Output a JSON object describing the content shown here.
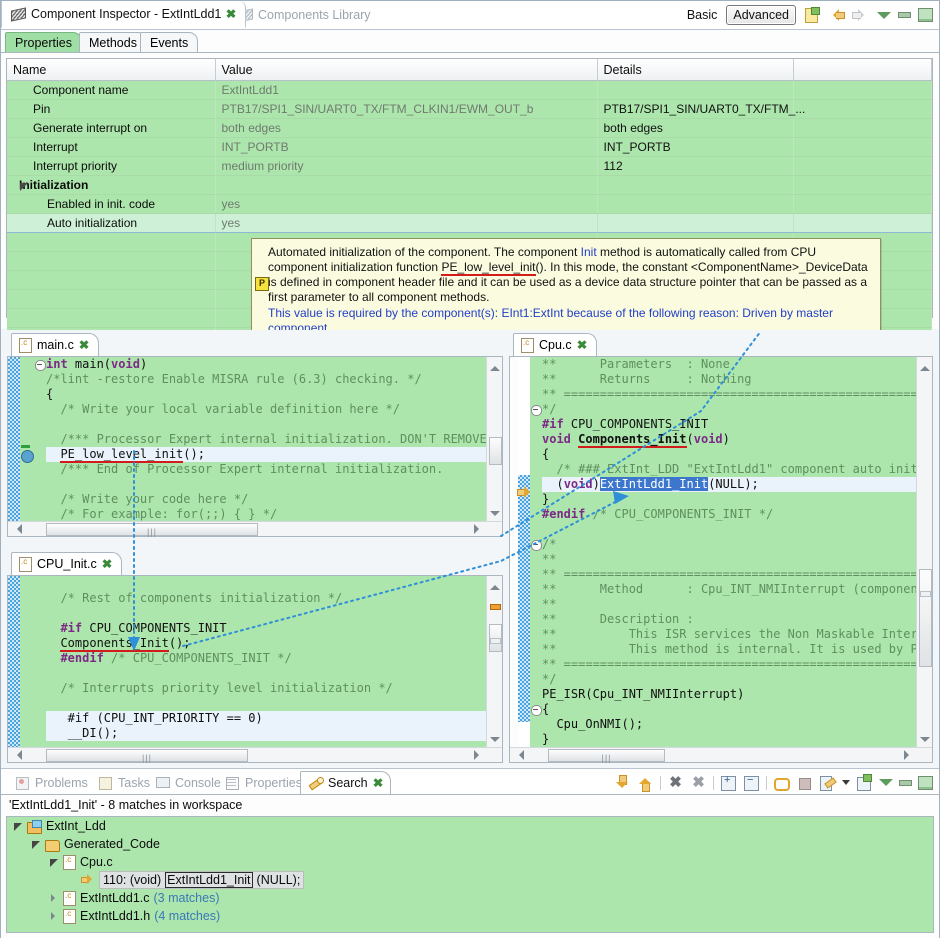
{
  "window": {
    "tabs": [
      {
        "label": "Component Inspector - ExtIntLdd1",
        "icon": "component-icon",
        "active": true,
        "closeable": true
      },
      {
        "label": "Components Library",
        "icon": "component-icon",
        "active": false,
        "closeable": false
      }
    ],
    "toolbar": {
      "basic_label": "Basic",
      "advanced_label": "Advanced",
      "icons": [
        "note-add-icon",
        "back-arrow-icon",
        "forward-arrow-icon",
        "view-menu-icon",
        "minimize-icon",
        "maximize-icon"
      ]
    }
  },
  "inspector": {
    "subtabs": [
      {
        "label": "Properties",
        "active": true
      },
      {
        "label": "Methods",
        "active": false
      },
      {
        "label": "Events",
        "active": false
      }
    ],
    "columns": [
      "Name",
      "Value",
      "Details",
      ""
    ],
    "rows": [
      {
        "name": "Component name",
        "value": "ExtIntLdd1",
        "details": "",
        "indent": 1,
        "group": false,
        "selected": false
      },
      {
        "name": "Pin",
        "value": "PTB17/SPI1_SIN/UART0_TX/FTM_CLKIN1/EWM_OUT_b",
        "details": "PTB17/SPI1_SIN/UART0_TX/FTM_...",
        "indent": 1,
        "group": false,
        "selected": false
      },
      {
        "name": "Generate interrupt on",
        "value": "both edges",
        "details": "both edges",
        "indent": 1,
        "group": false,
        "selected": false
      },
      {
        "name": "Interrupt",
        "value": "INT_PORTB",
        "details": "INT_PORTB",
        "indent": 1,
        "group": false,
        "selected": false
      },
      {
        "name": "Interrupt priority",
        "value": "medium priority",
        "details": "112",
        "indent": 1,
        "group": false,
        "selected": false
      },
      {
        "name": "Initialization",
        "value": "",
        "details": "",
        "indent": 0,
        "group": true,
        "selected": false
      },
      {
        "name": "Enabled in init. code",
        "value": "yes",
        "details": "",
        "indent": 2,
        "group": false,
        "selected": false
      },
      {
        "name": "Auto initialization",
        "value": "yes",
        "details": "",
        "indent": 2,
        "group": false,
        "selected": true
      }
    ]
  },
  "tooltip": {
    "seg1": "Automated initialization of the component. The component ",
    "init_word": "Init",
    "seg2": " method is automatically called from CPU component initialization function ",
    "fn": "PE_low_level_init",
    "seg3": "(). In this mode, the constant <ComponentName>_DeviceData is defined in component header file and it can be used as a device data structure pointer that can be passed as a first parameter to all component methods.",
    "required": "This value is required by the component(s): EInt1:ExtInt because of the following reason: Driven by master component.",
    "badge": "P"
  },
  "editors": {
    "main_c": {
      "tab": "main.c",
      "lines": [
        {
          "text": "int main(void)",
          "style": "code"
        },
        {
          "text": "/*lint -restore Enable MISRA rule (6.3) checking. */",
          "style": "comment"
        },
        {
          "text": "{",
          "style": "code"
        },
        {
          "text": "  /* Write your local variable definition here */",
          "style": "comment"
        },
        {
          "text": "",
          "style": "code"
        },
        {
          "text": "  /*** Processor Expert internal initialization. DON'T REMOVE",
          "style": "comment"
        },
        {
          "text": "  PE_low_level_init();",
          "style": "highlight-underlined"
        },
        {
          "text": "  /*** End of Processor Expert internal initialization.",
          "style": "comment"
        },
        {
          "text": "",
          "style": "code"
        },
        {
          "text": "  /* Write your code here */",
          "style": "comment"
        },
        {
          "text": "  /* For example: for(;;) { } */",
          "style": "comment"
        }
      ]
    },
    "cpu_init_c": {
      "tab": "CPU_Init.c",
      "lines": [
        {
          "text": "",
          "style": "code"
        },
        {
          "text": "  /* Rest of components initialization */",
          "style": "comment"
        },
        {
          "text": "",
          "style": "code"
        },
        {
          "text": "  #if CPU_COMPONENTS_INIT",
          "style": "pp"
        },
        {
          "text": "  Components_Init();",
          "style": "underlined"
        },
        {
          "text": "  #endif /* CPU_COMPONENTS_INIT */",
          "style": "pp"
        },
        {
          "text": "",
          "style": "code"
        },
        {
          "text": "  /* Interrupts priority level initialization */",
          "style": "comment"
        },
        {
          "text": "",
          "style": "code"
        },
        {
          "text": "   #if (CPU_INT_PRIORITY == 0)",
          "style": "highlight"
        },
        {
          "text": "   __DI();",
          "style": "highlight"
        }
      ]
    },
    "cpu_c": {
      "tab": "Cpu.c",
      "lines": [
        {
          "text": "**      Parameters  : None",
          "style": "comment"
        },
        {
          "text": "**      Returns     : Nothing",
          "style": "comment"
        },
        {
          "text": "** ===================================================",
          "style": "comment"
        },
        {
          "text": "*/",
          "style": "comment"
        },
        {
          "text": "#if CPU_COMPONENTS_INIT",
          "style": "pp"
        },
        {
          "text": "void Components_Init(void)",
          "style": "underlined-fn"
        },
        {
          "text": "{",
          "style": "code"
        },
        {
          "text": "  /* ### ExtInt_LDD \"ExtIntLdd1\" component auto init",
          "style": "comment"
        },
        {
          "text": "  (void)ExtIntLdd1_Init(NULL);",
          "style": "highlight-selection"
        },
        {
          "text": "}",
          "style": "code"
        },
        {
          "text": "#endif /* CPU_COMPONENTS_INIT */",
          "style": "pp"
        },
        {
          "text": "",
          "style": "code"
        },
        {
          "text": "/*",
          "style": "comment"
        },
        {
          "text": "**",
          "style": "comment"
        },
        {
          "text": "** ===================================================",
          "style": "comment"
        },
        {
          "text": "**      Method      : Cpu_INT_NMIInterrupt (componen",
          "style": "comment"
        },
        {
          "text": "**",
          "style": "comment"
        },
        {
          "text": "**      Description :",
          "style": "comment"
        },
        {
          "text": "**          This ISR services the Non Maskable Interr",
          "style": "comment"
        },
        {
          "text": "**          This method is internal. It is used by Pr",
          "style": "comment"
        },
        {
          "text": "** ===================================================",
          "style": "comment"
        },
        {
          "text": "*/",
          "style": "comment"
        },
        {
          "text": "PE_ISR(Cpu_INT_NMIInterrupt)",
          "style": "code"
        },
        {
          "text": "{",
          "style": "code"
        },
        {
          "text": "  Cpu_OnNMI();",
          "style": "code"
        },
        {
          "text": "}",
          "style": "code"
        }
      ]
    }
  },
  "bottom": {
    "tabs": [
      {
        "label": "Problems",
        "icon": "problems-icon",
        "active": false
      },
      {
        "label": "Tasks",
        "icon": "tasks-icon",
        "active": false
      },
      {
        "label": "Console",
        "icon": "console-icon",
        "active": false
      },
      {
        "label": "Properties",
        "icon": "properties-icon",
        "active": false
      },
      {
        "label": "Search",
        "icon": "search-icon",
        "active": true
      }
    ],
    "summary": "'ExtIntLdd1_Init' - 8 matches in workspace",
    "toolbar_icons": [
      "next-match-icon",
      "previous-match-icon",
      "remove-match-icon",
      "remove-all-matches-icon",
      "expand-all-icon",
      "collapse-all-icon",
      "link-with-editor-icon",
      "stop-icon",
      "search-history-icon",
      "search-history-dropdown-icon",
      "new-search-icon",
      "view-menu-icon",
      "minimize-icon",
      "maximize-icon"
    ],
    "tree": [
      {
        "label": "ExtInt_Ldd",
        "icon": "project-icon",
        "indent": 0,
        "twist": "open",
        "suffix": ""
      },
      {
        "label": "Generated_Code",
        "icon": "folder-icon",
        "indent": 1,
        "twist": "open",
        "suffix": ""
      },
      {
        "label": "Cpu.c",
        "icon": "c-file-icon",
        "indent": 2,
        "twist": "open",
        "suffix": ""
      },
      {
        "label": "110: (void)ExtIntLdd1_Init(NULL);",
        "icon": "match-icon",
        "indent": 3,
        "twist": "none",
        "suffix": "",
        "selected": true,
        "parts": {
          "prefix": "110: (void)",
          "boxed": "ExtIntLdd1_Init",
          "suffix": "(NULL);"
        }
      },
      {
        "label": "ExtIntLdd1.c",
        "icon": "c-file-icon",
        "indent": 2,
        "twist": "closed",
        "suffix": "(3 matches)"
      },
      {
        "label": "ExtIntLdd1.h",
        "icon": "c-file-icon",
        "indent": 2,
        "twist": "closed",
        "suffix": "(4 matches)"
      }
    ]
  },
  "colors": {
    "green_bg": "#ade6ad",
    "active_tab_green": "#9fdfa5",
    "tooltip_bg": "#fbfbdf",
    "selection_blue": "#3d77cd",
    "underline_red": "#d21b1b",
    "link_blue": "#3a78b8",
    "connector_blue": "#2f8fd8"
  }
}
